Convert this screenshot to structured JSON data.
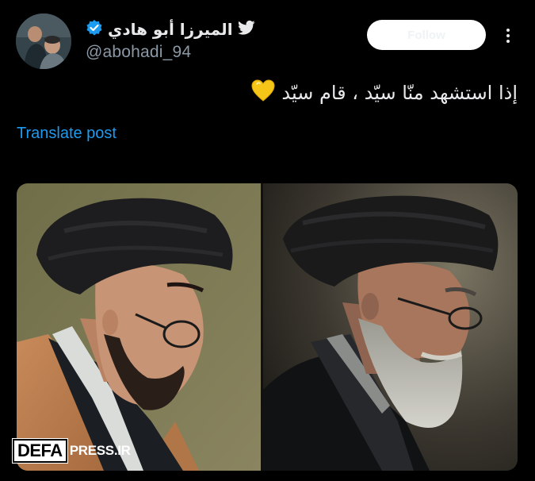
{
  "user": {
    "display_name": "الميرزا أبو هادي",
    "handle": "@abohadi_94",
    "verified": true
  },
  "actions": {
    "follow_label": "Follow"
  },
  "tweet": {
    "text": "إذا استشهد منّا سيّد ، قام سيّد",
    "emoji": "💛"
  },
  "translate": {
    "label": "Translate post"
  },
  "watermark": {
    "logo": "DEFA",
    "site": "PRESS.IR"
  },
  "colors": {
    "background": "#000000",
    "text": "#e7e9ea",
    "secondary_text": "#8b98a5",
    "link": "#1d9bf0",
    "verified_badge": "#1d9bf0"
  },
  "icons": {
    "bird": "bird-icon",
    "verified": "verified-badge-icon",
    "more": "more-options-icon"
  }
}
